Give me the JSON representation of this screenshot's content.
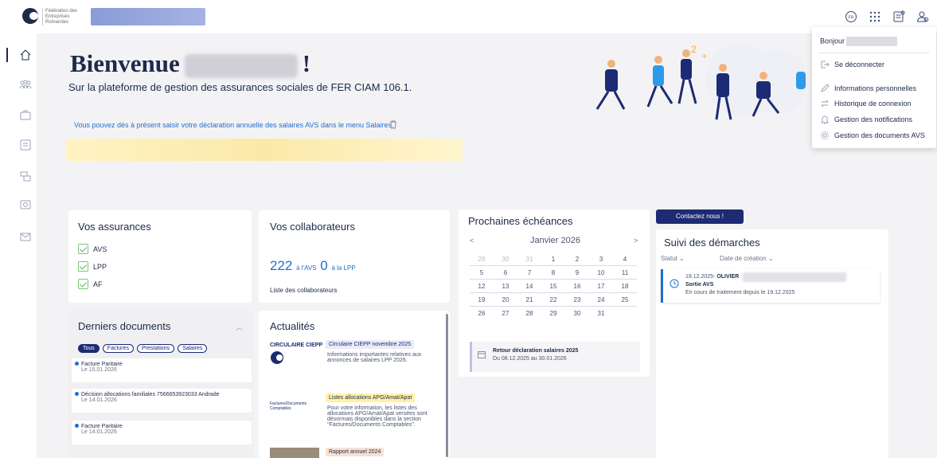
{
  "header": {
    "logo_text": "Fédération des\nEntreprises\nRomandes",
    "icons": [
      "user-fr-icon",
      "apps-grid-icon",
      "document-icon",
      "profile-icon"
    ]
  },
  "rail": {
    "items": [
      "home-icon",
      "people-icon",
      "briefcase-icon",
      "list-icon",
      "stack-icon",
      "camera-icon",
      "mail-icon"
    ]
  },
  "hero": {
    "welcome_prefix": "Bienvenue",
    "welcome_suffix": "!",
    "subtitle": "Sur la plateforme de gestion des assurances sociales de FER CIAM 106.1.",
    "info": "Vous pouvez dès à présent saisir votre déclaration annuelle des salaires AVS dans le menu Salaires."
  },
  "dropdown": {
    "greeting": "Bonjour",
    "items": [
      {
        "label": "Se déconnecter",
        "icon": "logout-icon"
      },
      {
        "label": "Informations personnelles",
        "icon": "pencil-icon"
      },
      {
        "label": "Historique de connexion",
        "icon": "swap-icon"
      },
      {
        "label": "Gestion des notifications",
        "icon": "bell-icon"
      },
      {
        "label": "Gestion des documents AVS",
        "icon": "settings-icon"
      }
    ]
  },
  "assurances": {
    "title": "Vos assurances",
    "items": [
      "AVS",
      "LPP",
      "AF"
    ]
  },
  "collaborateurs": {
    "title": "Vos collaborateurs",
    "avs_count": "222",
    "avs_label": "à l'AVS",
    "lpp_count": "0",
    "lpp_label": "à la LPP",
    "link": "Liste des collaborateurs"
  },
  "echeances": {
    "title": "Prochaines échéances",
    "prev": "<",
    "next": ">",
    "month": "Janvier 2026",
    "weeks": [
      [
        "29",
        "30",
        "31",
        "1",
        "2",
        "3",
        "4"
      ],
      [
        "5",
        "6",
        "7",
        "8",
        "9",
        "10",
        "11"
      ],
      [
        "12",
        "13",
        "14",
        "15",
        "16",
        "17",
        "18"
      ],
      [
        "19",
        "20",
        "21",
        "22",
        "23",
        "24",
        "25"
      ],
      [
        "26",
        "27",
        "28",
        "29",
        "30",
        "31",
        ""
      ]
    ],
    "event_title": "Retour déclaration salaires 2025",
    "event_dates": "Du 08.12.2025 au 30.01.2026"
  },
  "contact": {
    "label": "Contactez nous !"
  },
  "suivi": {
    "title": "Suivi des démarches",
    "filter_status": "Statut",
    "filter_date": "Date de création",
    "item_date": "19.12.2025-",
    "item_name": "OLIVIER",
    "item_type": "Sortie AVS",
    "item_status": "En cours de traitement depuis le 19.12.2025"
  },
  "documents": {
    "title": "Derniers documents",
    "chips": [
      "Tous",
      "Factures",
      "Prestations",
      "Salaires"
    ],
    "items": [
      {
        "name": "Facture Paritaire",
        "date": "Le 15.01.2026"
      },
      {
        "name": "Décision allocations familiales 7566653923033 Andrade",
        "date": "Le 14.01.2026"
      },
      {
        "name": "Facture Paritaire",
        "date": "Le 14.01.2026"
      }
    ]
  },
  "actualites": {
    "title": "Actualités",
    "items": [
      {
        "source": "CIRCULAIRE CIEPP",
        "tag": "Circulaire CIEPP novembre 2025",
        "body": "Informations importantes relatives aux annonces de salaires LPP 2026."
      },
      {
        "source": "Factures/Documents Comptables",
        "tag": "Listes allocations APG/Amat/Apat",
        "body": "Pour votre information, les listes des allocations APG/Amat/Apat versées sont désormais disponibles dans la section \"Factures/Documents Comptables\"."
      },
      {
        "source": "",
        "tag": "Rapport annuel 2024",
        "body": ""
      }
    ]
  },
  "colors": {
    "navy": "#1d2a4a",
    "accent": "#1e6fd0",
    "check": "#5bb55b",
    "highlight": "#fbe9a8"
  }
}
